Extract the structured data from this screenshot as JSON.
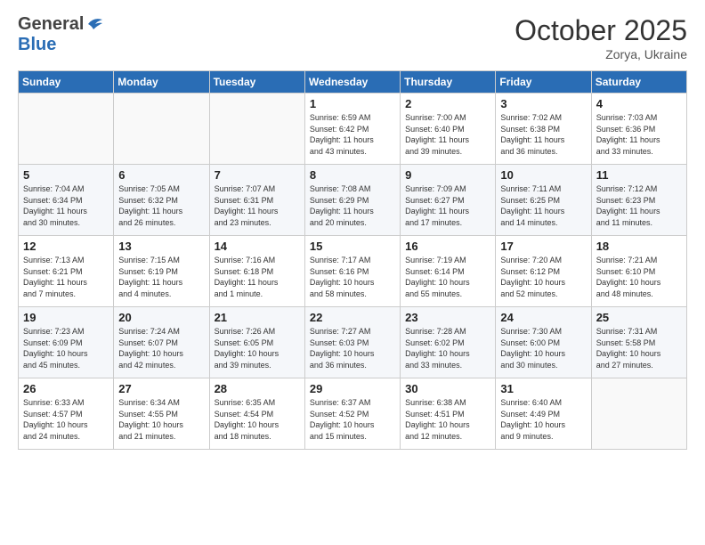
{
  "header": {
    "logo_line1": "General",
    "logo_line2": "Blue",
    "month": "October 2025",
    "location": "Zorya, Ukraine"
  },
  "weekdays": [
    "Sunday",
    "Monday",
    "Tuesday",
    "Wednesday",
    "Thursday",
    "Friday",
    "Saturday"
  ],
  "weeks": [
    [
      {
        "day": "",
        "info": ""
      },
      {
        "day": "",
        "info": ""
      },
      {
        "day": "",
        "info": ""
      },
      {
        "day": "1",
        "info": "Sunrise: 6:59 AM\nSunset: 6:42 PM\nDaylight: 11 hours\nand 43 minutes."
      },
      {
        "day": "2",
        "info": "Sunrise: 7:00 AM\nSunset: 6:40 PM\nDaylight: 11 hours\nand 39 minutes."
      },
      {
        "day": "3",
        "info": "Sunrise: 7:02 AM\nSunset: 6:38 PM\nDaylight: 11 hours\nand 36 minutes."
      },
      {
        "day": "4",
        "info": "Sunrise: 7:03 AM\nSunset: 6:36 PM\nDaylight: 11 hours\nand 33 minutes."
      }
    ],
    [
      {
        "day": "5",
        "info": "Sunrise: 7:04 AM\nSunset: 6:34 PM\nDaylight: 11 hours\nand 30 minutes."
      },
      {
        "day": "6",
        "info": "Sunrise: 7:05 AM\nSunset: 6:32 PM\nDaylight: 11 hours\nand 26 minutes."
      },
      {
        "day": "7",
        "info": "Sunrise: 7:07 AM\nSunset: 6:31 PM\nDaylight: 11 hours\nand 23 minutes."
      },
      {
        "day": "8",
        "info": "Sunrise: 7:08 AM\nSunset: 6:29 PM\nDaylight: 11 hours\nand 20 minutes."
      },
      {
        "day": "9",
        "info": "Sunrise: 7:09 AM\nSunset: 6:27 PM\nDaylight: 11 hours\nand 17 minutes."
      },
      {
        "day": "10",
        "info": "Sunrise: 7:11 AM\nSunset: 6:25 PM\nDaylight: 11 hours\nand 14 minutes."
      },
      {
        "day": "11",
        "info": "Sunrise: 7:12 AM\nSunset: 6:23 PM\nDaylight: 11 hours\nand 11 minutes."
      }
    ],
    [
      {
        "day": "12",
        "info": "Sunrise: 7:13 AM\nSunset: 6:21 PM\nDaylight: 11 hours\nand 7 minutes."
      },
      {
        "day": "13",
        "info": "Sunrise: 7:15 AM\nSunset: 6:19 PM\nDaylight: 11 hours\nand 4 minutes."
      },
      {
        "day": "14",
        "info": "Sunrise: 7:16 AM\nSunset: 6:18 PM\nDaylight: 11 hours\nand 1 minute."
      },
      {
        "day": "15",
        "info": "Sunrise: 7:17 AM\nSunset: 6:16 PM\nDaylight: 10 hours\nand 58 minutes."
      },
      {
        "day": "16",
        "info": "Sunrise: 7:19 AM\nSunset: 6:14 PM\nDaylight: 10 hours\nand 55 minutes."
      },
      {
        "day": "17",
        "info": "Sunrise: 7:20 AM\nSunset: 6:12 PM\nDaylight: 10 hours\nand 52 minutes."
      },
      {
        "day": "18",
        "info": "Sunrise: 7:21 AM\nSunset: 6:10 PM\nDaylight: 10 hours\nand 48 minutes."
      }
    ],
    [
      {
        "day": "19",
        "info": "Sunrise: 7:23 AM\nSunset: 6:09 PM\nDaylight: 10 hours\nand 45 minutes."
      },
      {
        "day": "20",
        "info": "Sunrise: 7:24 AM\nSunset: 6:07 PM\nDaylight: 10 hours\nand 42 minutes."
      },
      {
        "day": "21",
        "info": "Sunrise: 7:26 AM\nSunset: 6:05 PM\nDaylight: 10 hours\nand 39 minutes."
      },
      {
        "day": "22",
        "info": "Sunrise: 7:27 AM\nSunset: 6:03 PM\nDaylight: 10 hours\nand 36 minutes."
      },
      {
        "day": "23",
        "info": "Sunrise: 7:28 AM\nSunset: 6:02 PM\nDaylight: 10 hours\nand 33 minutes."
      },
      {
        "day": "24",
        "info": "Sunrise: 7:30 AM\nSunset: 6:00 PM\nDaylight: 10 hours\nand 30 minutes."
      },
      {
        "day": "25",
        "info": "Sunrise: 7:31 AM\nSunset: 5:58 PM\nDaylight: 10 hours\nand 27 minutes."
      }
    ],
    [
      {
        "day": "26",
        "info": "Sunrise: 6:33 AM\nSunset: 4:57 PM\nDaylight: 10 hours\nand 24 minutes."
      },
      {
        "day": "27",
        "info": "Sunrise: 6:34 AM\nSunset: 4:55 PM\nDaylight: 10 hours\nand 21 minutes."
      },
      {
        "day": "28",
        "info": "Sunrise: 6:35 AM\nSunset: 4:54 PM\nDaylight: 10 hours\nand 18 minutes."
      },
      {
        "day": "29",
        "info": "Sunrise: 6:37 AM\nSunset: 4:52 PM\nDaylight: 10 hours\nand 15 minutes."
      },
      {
        "day": "30",
        "info": "Sunrise: 6:38 AM\nSunset: 4:51 PM\nDaylight: 10 hours\nand 12 minutes."
      },
      {
        "day": "31",
        "info": "Sunrise: 6:40 AM\nSunset: 4:49 PM\nDaylight: 10 hours\nand 9 minutes."
      },
      {
        "day": "",
        "info": ""
      }
    ]
  ]
}
